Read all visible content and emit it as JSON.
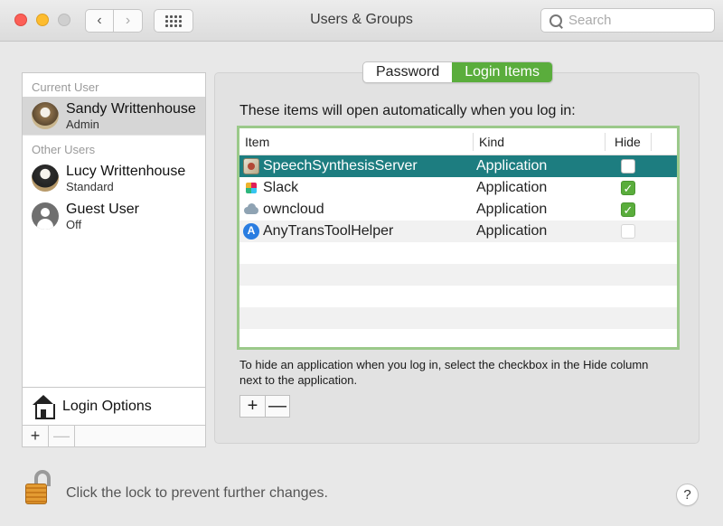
{
  "window": {
    "title": "Users & Groups",
    "search_placeholder": "Search"
  },
  "sidebar": {
    "current_user_label": "Current User",
    "current_user": {
      "name": "Sandy Writtenhouse",
      "role": "Admin"
    },
    "other_users_label": "Other Users",
    "other_users": [
      {
        "name": "Lucy Writtenhouse",
        "role": "Standard"
      },
      {
        "name": "Guest User",
        "role": "Off"
      }
    ],
    "login_options_label": "Login Options",
    "add_label": "+",
    "remove_label": "—"
  },
  "tabs": [
    {
      "label": "Password",
      "active": false
    },
    {
      "label": "Login Items",
      "active": true
    }
  ],
  "main": {
    "instructions": "These items will open automatically when you log in:",
    "columns": {
      "item": "Item",
      "kind": "Kind",
      "hide": "Hide"
    },
    "items": [
      {
        "name": "SpeechSynthesisServer",
        "kind": "Application",
        "hide": false,
        "selected": true
      },
      {
        "name": "Slack",
        "kind": "Application",
        "hide": true,
        "selected": false
      },
      {
        "name": "owncloud",
        "kind": "Application",
        "hide": true,
        "selected": false
      },
      {
        "name": "AnyTransToolHelper",
        "kind": "Application",
        "hide": false,
        "selected": false
      }
    ],
    "hint": "To hide an application when you log in, select the checkbox in the Hide column next to the application.",
    "add_label": "+",
    "remove_label": "—"
  },
  "footer": {
    "lock_text": "Click the lock to prevent further changes.",
    "help_label": "?"
  },
  "colors": {
    "accent_green": "#5aad3c",
    "selected_row": "#1d7d80",
    "table_border": "#9bc98a"
  }
}
